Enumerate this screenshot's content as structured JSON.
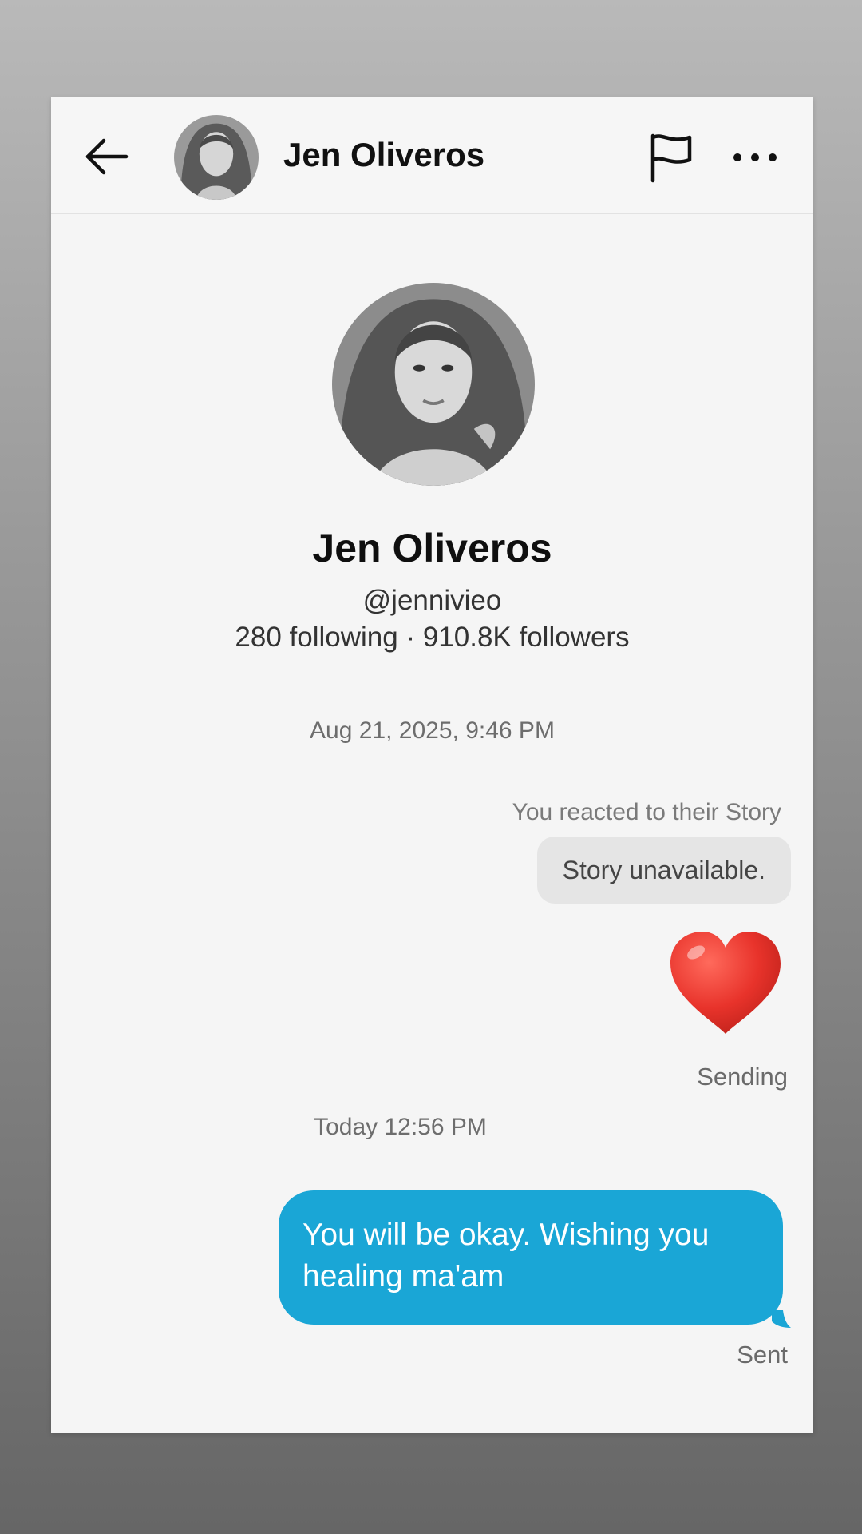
{
  "header": {
    "name": "Jen Oliveros"
  },
  "profile": {
    "name": "Jen Oliveros",
    "handle": "@jennivieo",
    "stats": "280 following · 910.8K followers"
  },
  "conversation": {
    "timestamp_1": "Aug 21, 2025, 9:46 PM",
    "reacted_label": "You reacted to their Story",
    "story_unavailable": "Story unavailable.",
    "reaction_emoji": "heart-emoji",
    "sending_status": "Sending",
    "timestamp_2": "Today 12:56 PM",
    "message_text": "You will be okay. Wishing you healing ma'am",
    "sent_status": "Sent"
  },
  "icons": {
    "back": "arrow-left-icon",
    "report": "flag-icon",
    "more": "more-horizontal-icon"
  },
  "colors": {
    "sent_bubble": "#1aa6d6",
    "story_bubble": "#e5e5e5",
    "heart": "#e8332b"
  }
}
